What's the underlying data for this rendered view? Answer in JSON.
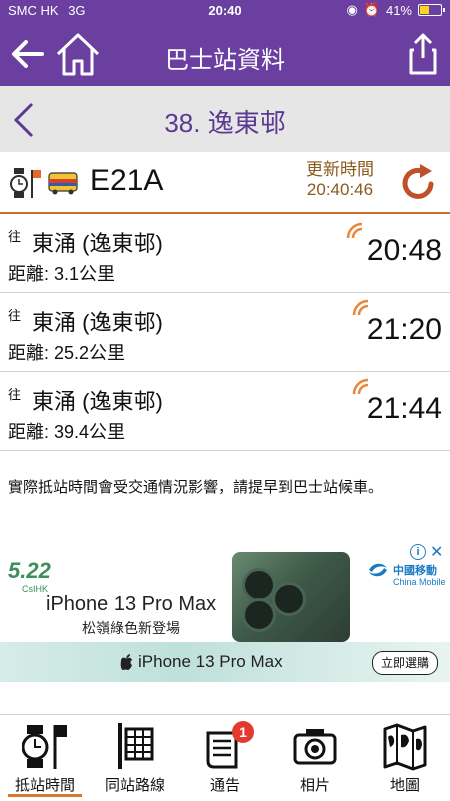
{
  "status_bar": {
    "carrier": "SMC HK",
    "network": "3G",
    "time": "20:40",
    "battery": "41%",
    "battery_level": 0.41
  },
  "nav": {
    "title": "巴士站資料"
  },
  "stop": {
    "name": "38. 逸東邨"
  },
  "route": {
    "number": "E21A",
    "update_label": "更新時間",
    "update_time": "20:40:46"
  },
  "etas": [
    {
      "to_label": "往",
      "destination": "東涌 (逸東邨)",
      "distance": "距離: 3.1公里",
      "time": "20:48"
    },
    {
      "to_label": "往",
      "destination": "東涌 (逸東邨)",
      "distance": "距離: 25.2公里",
      "time": "21:20"
    },
    {
      "to_label": "往",
      "destination": "東涌 (逸東邨)",
      "distance": "距離: 39.4公里",
      "time": "21:44"
    }
  ],
  "notice": "實際抵站時間會受交通情況影響，請提早到巴士站候車。",
  "ad": {
    "brand_badge": "5.22",
    "brand_sub": "CsIHK",
    "product": "iPhone 13 Pro Max",
    "subtitle": "松嶺綠色新登場",
    "carrier_name": "中國移動",
    "carrier_sub": "China Mobile",
    "strip_text": "iPhone 13 Pro Max",
    "buy_label": "立即選購",
    "info_icon": "i",
    "close_icon": "✕"
  },
  "tabs": [
    {
      "label": "抵站時間",
      "icon": "watch-flag-icon"
    },
    {
      "label": "同站路線",
      "icon": "bus-stop-icon"
    },
    {
      "label": "通告",
      "icon": "notice-icon",
      "badge": "1"
    },
    {
      "label": "相片",
      "icon": "camera-icon"
    },
    {
      "label": "地圖",
      "icon": "map-icon"
    }
  ],
  "colors": {
    "brand": "#6a3fa0",
    "accent": "#d9772c",
    "stop_text": "#5b3a92",
    "update_text": "#8a5a1c"
  }
}
